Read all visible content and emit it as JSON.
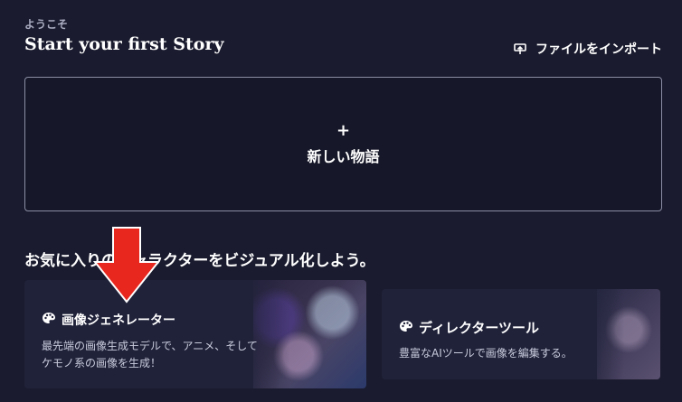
{
  "header": {
    "welcome": "ようこそ",
    "title": "Start your first Story",
    "import_label": "ファイルをインポート",
    "import_icon": "upload-box-icon"
  },
  "new_story": {
    "plus": "+",
    "label": "新しい物語"
  },
  "section": {
    "heading": "お気に入りのキャラクターをビジュアル化しよう。"
  },
  "cards": [
    {
      "icon": "palette-icon",
      "title": "画像ジェネレーター",
      "description": "最先端の画像生成モデルで、アニメ、そしてケモノ系の画像を生成！"
    },
    {
      "icon": "palette-icon",
      "title": "ディレクターツール",
      "description": "豊富なAIツールで画像を編集する。"
    }
  ],
  "overlay": {
    "arrow_color": "#e8271e"
  }
}
